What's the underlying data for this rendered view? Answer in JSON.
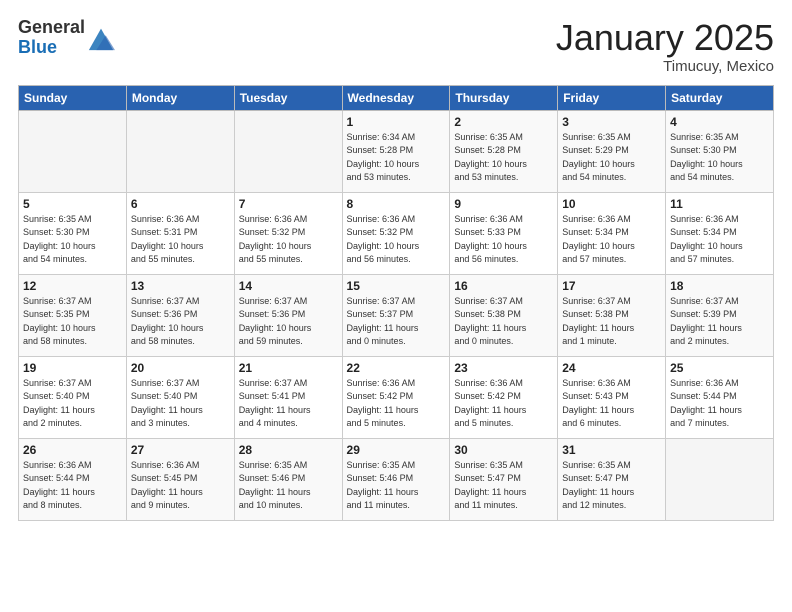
{
  "header": {
    "logo_general": "General",
    "logo_blue": "Blue",
    "title": "January 2025",
    "subtitle": "Timucuy, Mexico"
  },
  "weekdays": [
    "Sunday",
    "Monday",
    "Tuesday",
    "Wednesday",
    "Thursday",
    "Friday",
    "Saturday"
  ],
  "weeks": [
    [
      {
        "day": "",
        "info": ""
      },
      {
        "day": "",
        "info": ""
      },
      {
        "day": "",
        "info": ""
      },
      {
        "day": "1",
        "info": "Sunrise: 6:34 AM\nSunset: 5:28 PM\nDaylight: 10 hours\nand 53 minutes."
      },
      {
        "day": "2",
        "info": "Sunrise: 6:35 AM\nSunset: 5:28 PM\nDaylight: 10 hours\nand 53 minutes."
      },
      {
        "day": "3",
        "info": "Sunrise: 6:35 AM\nSunset: 5:29 PM\nDaylight: 10 hours\nand 54 minutes."
      },
      {
        "day": "4",
        "info": "Sunrise: 6:35 AM\nSunset: 5:30 PM\nDaylight: 10 hours\nand 54 minutes."
      }
    ],
    [
      {
        "day": "5",
        "info": "Sunrise: 6:35 AM\nSunset: 5:30 PM\nDaylight: 10 hours\nand 54 minutes."
      },
      {
        "day": "6",
        "info": "Sunrise: 6:36 AM\nSunset: 5:31 PM\nDaylight: 10 hours\nand 55 minutes."
      },
      {
        "day": "7",
        "info": "Sunrise: 6:36 AM\nSunset: 5:32 PM\nDaylight: 10 hours\nand 55 minutes."
      },
      {
        "day": "8",
        "info": "Sunrise: 6:36 AM\nSunset: 5:32 PM\nDaylight: 10 hours\nand 56 minutes."
      },
      {
        "day": "9",
        "info": "Sunrise: 6:36 AM\nSunset: 5:33 PM\nDaylight: 10 hours\nand 56 minutes."
      },
      {
        "day": "10",
        "info": "Sunrise: 6:36 AM\nSunset: 5:34 PM\nDaylight: 10 hours\nand 57 minutes."
      },
      {
        "day": "11",
        "info": "Sunrise: 6:36 AM\nSunset: 5:34 PM\nDaylight: 10 hours\nand 57 minutes."
      }
    ],
    [
      {
        "day": "12",
        "info": "Sunrise: 6:37 AM\nSunset: 5:35 PM\nDaylight: 10 hours\nand 58 minutes."
      },
      {
        "day": "13",
        "info": "Sunrise: 6:37 AM\nSunset: 5:36 PM\nDaylight: 10 hours\nand 58 minutes."
      },
      {
        "day": "14",
        "info": "Sunrise: 6:37 AM\nSunset: 5:36 PM\nDaylight: 10 hours\nand 59 minutes."
      },
      {
        "day": "15",
        "info": "Sunrise: 6:37 AM\nSunset: 5:37 PM\nDaylight: 11 hours\nand 0 minutes."
      },
      {
        "day": "16",
        "info": "Sunrise: 6:37 AM\nSunset: 5:38 PM\nDaylight: 11 hours\nand 0 minutes."
      },
      {
        "day": "17",
        "info": "Sunrise: 6:37 AM\nSunset: 5:38 PM\nDaylight: 11 hours\nand 1 minute."
      },
      {
        "day": "18",
        "info": "Sunrise: 6:37 AM\nSunset: 5:39 PM\nDaylight: 11 hours\nand 2 minutes."
      }
    ],
    [
      {
        "day": "19",
        "info": "Sunrise: 6:37 AM\nSunset: 5:40 PM\nDaylight: 11 hours\nand 2 minutes."
      },
      {
        "day": "20",
        "info": "Sunrise: 6:37 AM\nSunset: 5:40 PM\nDaylight: 11 hours\nand 3 minutes."
      },
      {
        "day": "21",
        "info": "Sunrise: 6:37 AM\nSunset: 5:41 PM\nDaylight: 11 hours\nand 4 minutes."
      },
      {
        "day": "22",
        "info": "Sunrise: 6:36 AM\nSunset: 5:42 PM\nDaylight: 11 hours\nand 5 minutes."
      },
      {
        "day": "23",
        "info": "Sunrise: 6:36 AM\nSunset: 5:42 PM\nDaylight: 11 hours\nand 5 minutes."
      },
      {
        "day": "24",
        "info": "Sunrise: 6:36 AM\nSunset: 5:43 PM\nDaylight: 11 hours\nand 6 minutes."
      },
      {
        "day": "25",
        "info": "Sunrise: 6:36 AM\nSunset: 5:44 PM\nDaylight: 11 hours\nand 7 minutes."
      }
    ],
    [
      {
        "day": "26",
        "info": "Sunrise: 6:36 AM\nSunset: 5:44 PM\nDaylight: 11 hours\nand 8 minutes."
      },
      {
        "day": "27",
        "info": "Sunrise: 6:36 AM\nSunset: 5:45 PM\nDaylight: 11 hours\nand 9 minutes."
      },
      {
        "day": "28",
        "info": "Sunrise: 6:35 AM\nSunset: 5:46 PM\nDaylight: 11 hours\nand 10 minutes."
      },
      {
        "day": "29",
        "info": "Sunrise: 6:35 AM\nSunset: 5:46 PM\nDaylight: 11 hours\nand 11 minutes."
      },
      {
        "day": "30",
        "info": "Sunrise: 6:35 AM\nSunset: 5:47 PM\nDaylight: 11 hours\nand 11 minutes."
      },
      {
        "day": "31",
        "info": "Sunrise: 6:35 AM\nSunset: 5:47 PM\nDaylight: 11 hours\nand 12 minutes."
      },
      {
        "day": "",
        "info": ""
      }
    ]
  ]
}
